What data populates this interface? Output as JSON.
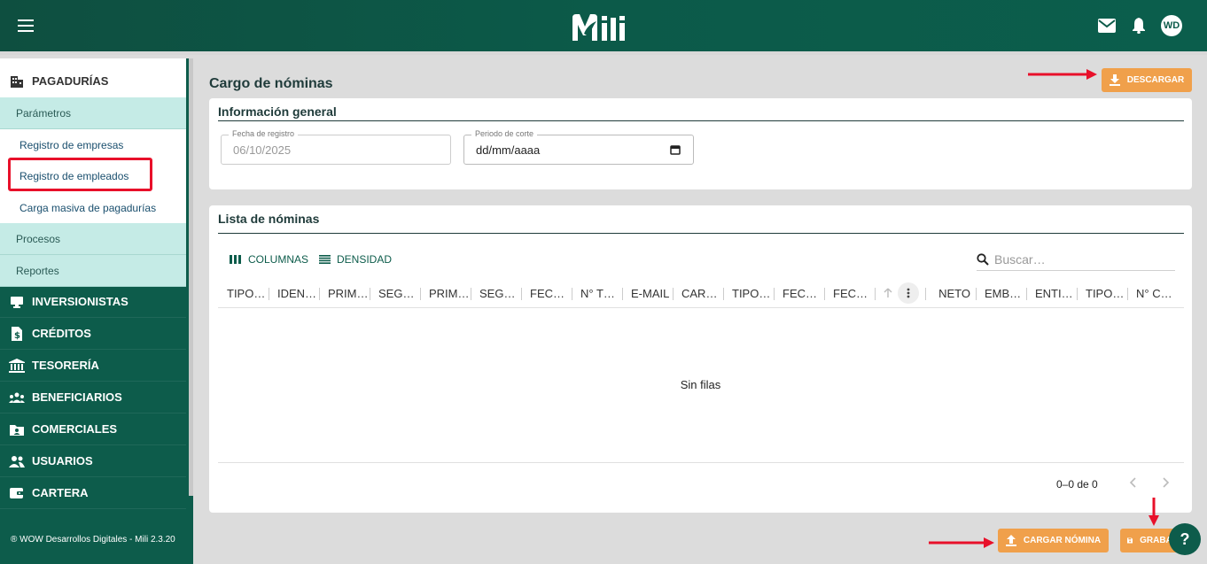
{
  "header": {
    "logo": "Mili",
    "avatar": "WD",
    "icons": [
      "menu-icon",
      "mail-icon",
      "bell-icon"
    ]
  },
  "sidebar": {
    "sections": [
      {
        "label": "PAGADURÍAS",
        "icon": "building-icon"
      },
      {
        "label": "INVERSIONISTAS",
        "icon": "desktop-icon"
      },
      {
        "label": "CRÉDITOS",
        "icon": "dollar-file-icon"
      },
      {
        "label": "TESORERÍA",
        "icon": "bank-icon"
      },
      {
        "label": "BENEFICIARIOS",
        "icon": "group-icon"
      },
      {
        "label": "COMERCIALES",
        "icon": "contact-folder-icon"
      },
      {
        "label": "USUARIOS",
        "icon": "users-icon"
      },
      {
        "label": "CARTERA",
        "icon": "wallet-icon"
      }
    ],
    "submenu": {
      "parametros": "Parámetros",
      "links": [
        "Registro de empresas",
        "Registro de empleados",
        "Carga masiva de pagadurías"
      ],
      "procesos": "Procesos",
      "reportes": "Reportes"
    },
    "footer": "® WOW Desarrollos Digitales - Mili 2.3.20"
  },
  "main": {
    "title": "Cargo de nóminas",
    "download_label": "DESCARGAR",
    "general": {
      "title": "Información general",
      "fecha_label": "Fecha de registro",
      "fecha_value": "06/10/2025",
      "periodo_label": "Periodo de corte",
      "periodo_value": "dd/mm/aaaa"
    },
    "list": {
      "title": "Lista de nóminas",
      "columns_label": "COLUMNAS",
      "density_label": "DENSIDAD",
      "search_placeholder": "Buscar…",
      "headers": [
        "TIPO…",
        "IDEN…",
        "PRIM…",
        "SEG…",
        "PRIM…",
        "SEG…",
        "FEC…",
        "N° T…",
        "E-MAIL",
        "CAR…",
        "TIPO…",
        "FEC…",
        "FEC…",
        "",
        "NETO",
        "EMB…",
        "ENTI…",
        "TIPO…",
        "N° C…"
      ],
      "empty": "Sin filas",
      "pagination": "0–0 de 0"
    },
    "upload_label": "CARGAR NÓMINA",
    "save_label": "GRABAR",
    "help": "?"
  }
}
